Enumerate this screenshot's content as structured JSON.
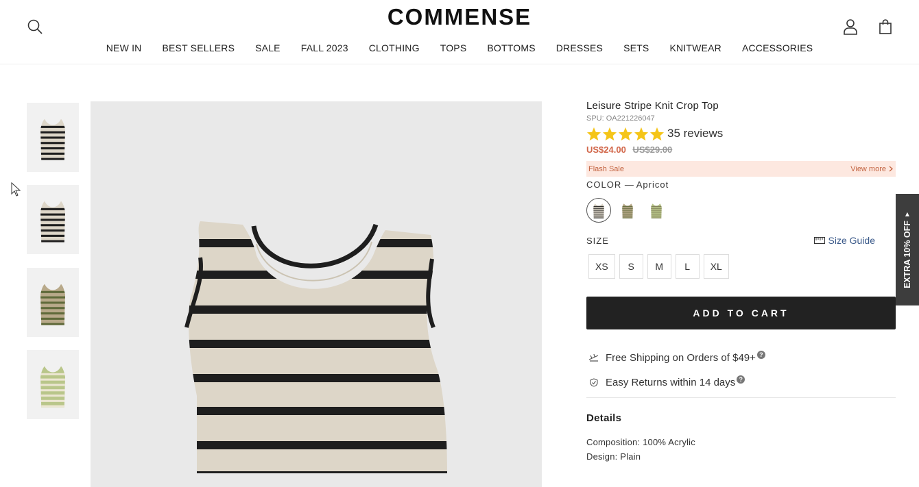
{
  "brand": {
    "logo": "COMMENSE"
  },
  "nav": [
    "NEW IN",
    "BEST SELLERS",
    "SALE",
    "FALL 2023",
    "CLOTHING",
    "TOPS",
    "BOTTOMS",
    "DRESSES",
    "SETS",
    "KNITWEAR",
    "ACCESSORIES"
  ],
  "icons": {
    "search": "search-icon",
    "account": "user-icon",
    "cart": "shopping-bag-icon"
  },
  "thumbnails": [
    {
      "color": "#ddd6c8",
      "stripe": "#1e1e1e",
      "active": true
    },
    {
      "color": "#ddd6c8",
      "stripe": "#1e1e1e",
      "active": false
    },
    {
      "color": "#b8a98a",
      "stripe": "#5f6a3a",
      "active": false
    },
    {
      "color": "#b9c68a",
      "stripe": "#ece6d2",
      "active": false
    }
  ],
  "product": {
    "title": "Leisure Stripe Knit Crop Top",
    "spu": "SPU: OA221226047",
    "rating": 5,
    "reviews": "35 reviews",
    "price_now": "US$24.00",
    "price_old": "US$29.00",
    "flash_sale": "Flash Sale",
    "view_more": "View more",
    "color_label": "COLOR",
    "color_sep": "—",
    "color_value": "Apricot",
    "swatches": [
      {
        "name": "Apricot",
        "color": "#ddd6c8",
        "stripe": "#1e1e1e"
      },
      {
        "name": "Khaki",
        "color": "#b8a98a",
        "stripe": "#5f6a3a"
      },
      {
        "name": "Green",
        "color": "#b9c68a",
        "stripe": "#7d7a55"
      }
    ],
    "size_label": "SIZE",
    "size_guide": "Size Guide",
    "sizes": [
      "XS",
      "S",
      "M",
      "L",
      "XL"
    ],
    "add_to_cart": "ADD TO CART",
    "free_shipping": "Free Shipping on Orders of $49+",
    "easy_returns": "Easy Returns within 14 days",
    "details_title": "Details",
    "composition_label": "Composition:",
    "composition_value": "100% Acrylic",
    "design_label": "Design:",
    "design_value": "Plain"
  },
  "side_tab": {
    "label": "EXTRA 10% OFF"
  },
  "colors": {
    "accent": "#222222",
    "price": "#d2674a",
    "flash_bg": "#fde8e0",
    "star": "#f5c518",
    "side_tab_bg": "#3d3d3d"
  }
}
